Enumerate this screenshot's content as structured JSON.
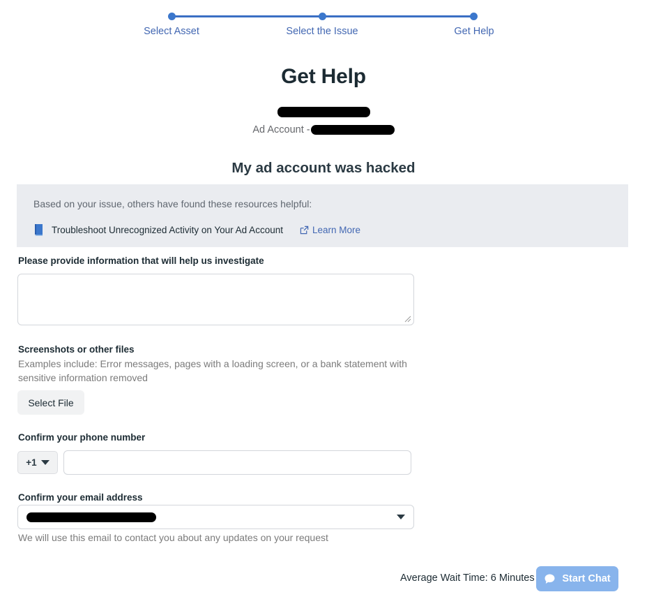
{
  "stepper": {
    "steps": [
      {
        "label": "Select Asset"
      },
      {
        "label": "Select the Issue"
      },
      {
        "label": "Get Help"
      }
    ],
    "accent_color": "#3b77cc",
    "label_color": "#4267b2"
  },
  "header": {
    "title": "Get Help",
    "account_name": "[REDACTED]",
    "ad_account_prefix": "Ad Account -",
    "ad_account_id": "[REDACTED]"
  },
  "issue": {
    "heading": "My ad account was hacked"
  },
  "resources": {
    "intro": "Based on your issue, others have found these resources helpful:",
    "background_color": "#eaecf0",
    "items": [
      {
        "icon": "book-icon",
        "title": "Troubleshoot Unrecognized Activity on Your Ad Account",
        "link_label": "Learn More",
        "link_icon": "external-link-icon"
      }
    ]
  },
  "form": {
    "investigate": {
      "label": "Please provide information that will help us investigate",
      "value": "",
      "placeholder": ""
    },
    "files": {
      "label": "Screenshots or other files",
      "help": "Examples include: Error messages, pages with a loading screen, or a bank statement with sensitive information removed",
      "button_label": "Select File"
    },
    "phone": {
      "label": "Confirm your phone number",
      "country_code": "+1",
      "value": "",
      "placeholder": ""
    },
    "email": {
      "label": "Confirm your email address",
      "value": "[REDACTED]",
      "help": "We will use this email to contact you about any updates on your request"
    }
  },
  "footer": {
    "wait_time": "Average Wait Time: 6 Minutes",
    "start_chat_label": "Start Chat",
    "start_chat_color": "#88b4ec",
    "chat_icon": "chat-bubble-icon"
  }
}
